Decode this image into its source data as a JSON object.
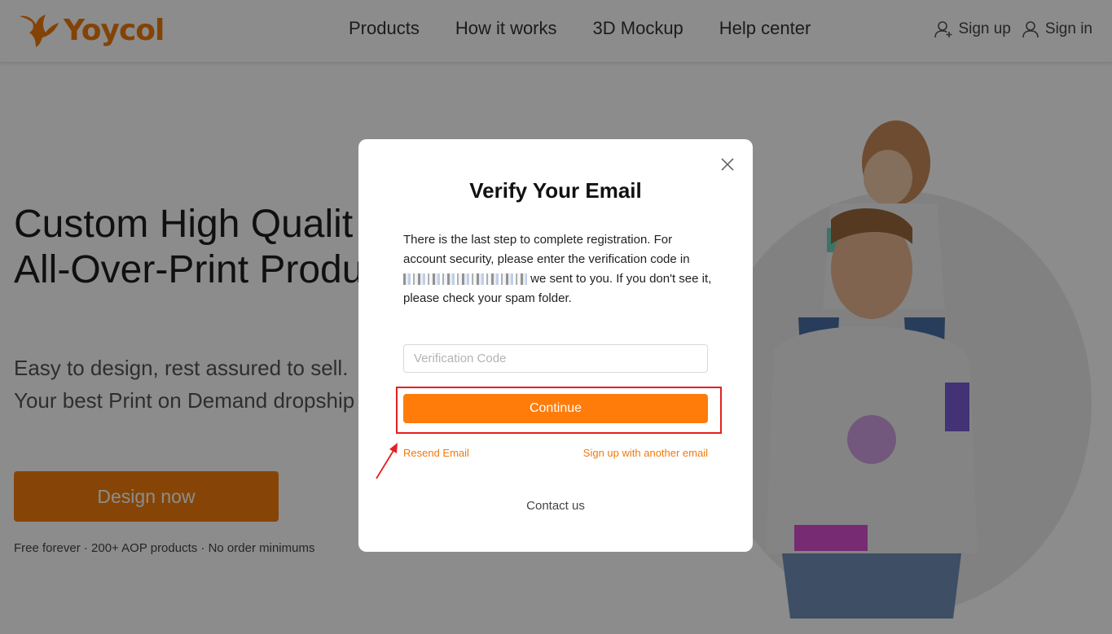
{
  "header": {
    "brand": "Yoycol",
    "nav": [
      "Products",
      "How it works",
      "3D Mockup",
      "Help center"
    ],
    "sign_up": "Sign up",
    "sign_in": "Sign in"
  },
  "hero": {
    "title_line1": "Custom High Qualit",
    "title_line2": "All-Over-Print Produ",
    "subtitle_line1": "Easy to design, rest assured to sell.",
    "subtitle_line2": "Your best Print on Demand dropship",
    "cta": "Design now",
    "footnote": "Free forever · 200+ AOP products · No order minimums"
  },
  "modal": {
    "title": "Verify Your Email",
    "text_before": "There is the last step to complete registration. For account security, please enter the verification code in ",
    "text_after": " we sent to you. If you don't see it, please check your spam folder.",
    "input_placeholder": "Verification Code",
    "input_value": "",
    "continue": "Continue",
    "resend": "Resend Email",
    "another_email": "Sign up with another email",
    "contact": "Contact us"
  },
  "colors": {
    "brand": "#f07a0c",
    "button": "#ff7c0a",
    "highlight": "#e52020"
  },
  "icons": {
    "close": "close-icon",
    "sign_up": "user-plus-icon",
    "sign_in": "user-icon"
  }
}
